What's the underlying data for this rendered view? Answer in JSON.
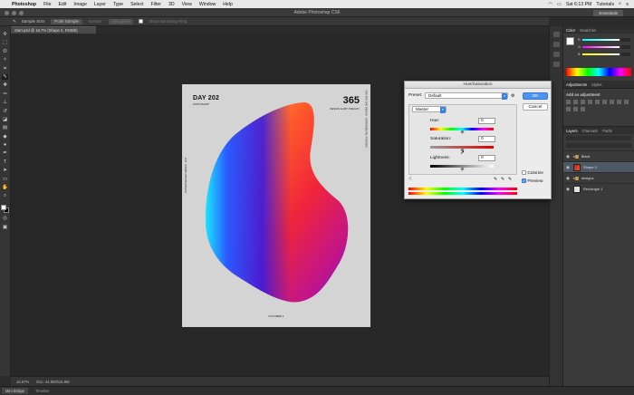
{
  "menubar": {
    "apple": "",
    "app": "Photoshop",
    "items": [
      "File",
      "Edit",
      "Image",
      "Layer",
      "Type",
      "Select",
      "Filter",
      "3D",
      "View",
      "Window",
      "Help"
    ],
    "clock": "Sat 6:13 PM",
    "user": "Tutorials"
  },
  "window": {
    "title": "Adobe Photoshop CS6",
    "workspace": "Essentials"
  },
  "options_bar": {
    "sample_size_label": "Sample Size:",
    "sample_size_value": "Point Sample",
    "sample_label": "Sample:",
    "sample_value": "All Layers",
    "show_ring": "Show Sampling Ring"
  },
  "document": {
    "tab": "Start.psd @ 16.7% (Shape 2, RGB/8)"
  },
  "poster": {
    "day": "DAY 202",
    "day_sub": "PHOTOSHOP",
    "big": "365",
    "big_sub": "DESIGN & ART ONE DAY",
    "left_vertical": "POSTER DESIGN SERIES · 2017",
    "right_vertical": "ONE DAY ONE DESIGN · EXPERIMENTAL POSTERS",
    "footer": "OCTOBER 1"
  },
  "status": {
    "zoom": "16.67%",
    "doc": "Doc: 44.9M/116.9M"
  },
  "bottom_tabs": [
    "Mini Bridge",
    "Timeline"
  ],
  "right_panel": {
    "color_tabs": [
      "Color",
      "Swatches"
    ],
    "rgb_labels": [
      "R",
      "G",
      "B"
    ],
    "adj_tabs": [
      "Adjustments",
      "Styles"
    ],
    "adj_label": "Add an adjustment",
    "layer_tabs": [
      "Layers",
      "Channels",
      "Paths"
    ],
    "layers": [
      {
        "name": "Black",
        "thumb": "dark",
        "folder": true,
        "selected": false
      },
      {
        "name": "Shape 2",
        "thumb": "red",
        "folder": false,
        "selected": true
      },
      {
        "name": "designs",
        "thumb": "dark",
        "folder": true,
        "selected": false
      },
      {
        "name": "Rectangle 1",
        "thumb": "white",
        "folder": false,
        "selected": false
      }
    ]
  },
  "dialog": {
    "title": "Hue/Saturation",
    "preset_label": "Preset:",
    "preset_value": "Default",
    "ok": "OK",
    "cancel": "Cancel",
    "channel": "Master",
    "hue_label": "Hue:",
    "hue_value": "0",
    "saturation_label": "Saturation:",
    "saturation_value": "0",
    "lightness_label": "Lightness:",
    "lightness_value": "0",
    "colorize": "Colorize",
    "preview": "Preview",
    "preview_checked": true,
    "colorize_checked": false
  }
}
